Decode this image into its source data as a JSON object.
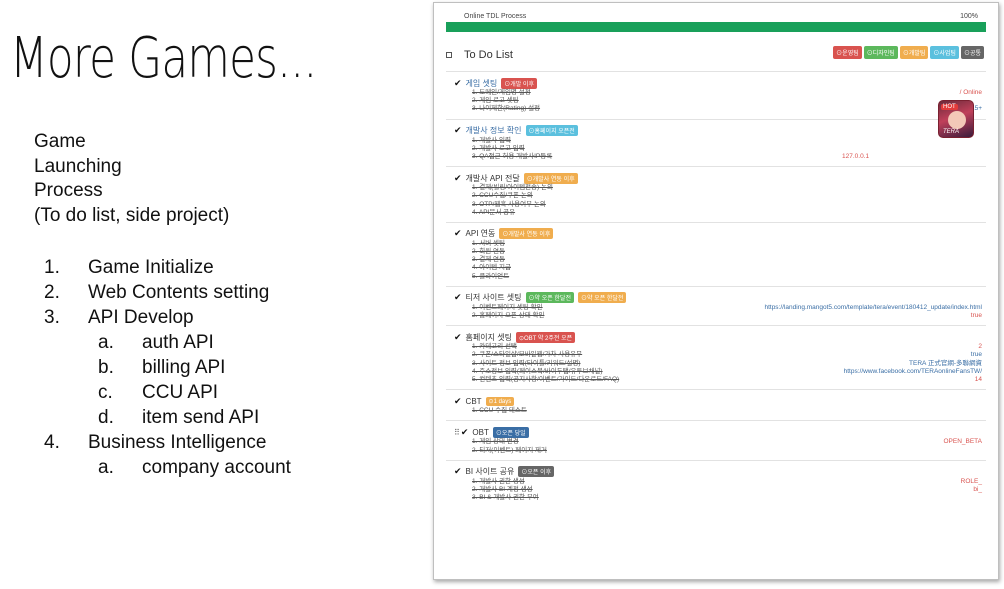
{
  "slide": {
    "title": "More Games...",
    "intro": [
      "Game",
      "Launching",
      "Process",
      "(To do list, side project)"
    ],
    "outline": [
      {
        "num": "1.",
        "text": "Game Initialize",
        "subs": []
      },
      {
        "num": "2.",
        "text": "Web Contents setting",
        "subs": []
      },
      {
        "num": "3.",
        "text": "API Develop",
        "subs": [
          {
            "num": "a.",
            "text": "auth API"
          },
          {
            "num": "b.",
            "text": "billing API"
          },
          {
            "num": "c.",
            "text": "CCU API"
          },
          {
            "num": "d.",
            "text": "item send API"
          }
        ]
      },
      {
        "num": "4.",
        "text": "Business Intelligence",
        "subs": [
          {
            "num": "a.",
            "text": "company account"
          }
        ]
      }
    ]
  },
  "screenshot": {
    "progress": {
      "label": "Online TDL Process",
      "percent_label": "100%",
      "value": 1.0,
      "color": "#19a05a"
    },
    "todo_title": "To Do List",
    "legend": [
      {
        "label": "⊙운영팀",
        "color": "#d9534f"
      },
      {
        "label": "⊙디자인팀",
        "color": "#5cb85c"
      },
      {
        "label": "⊙개발팀",
        "color": "#f0ad4e"
      },
      {
        "label": "⊙사업팀",
        "color": "#5bc0de"
      },
      {
        "label": "⊙공통",
        "color": "#666666"
      }
    ],
    "game_icon": {
      "badge": "HOT",
      "label": "TERA"
    },
    "cards": [
      {
        "title": "게임 셋팅",
        "title_color": "#3a6ea5",
        "drag": false,
        "tags": [
          {
            "label": "⊙개발 이후",
            "color": "#d9534f"
          }
        ],
        "items": [
          {
            "text": "1. 도메인/게임명 설정",
            "right": "/       Online",
            "right_color": "#d9534f"
          },
          {
            "text": "2. 게임 로고 셋팅"
          },
          {
            "text": "3. 나이제한(Rating) 설정",
            "right": "15+",
            "right_color": "#3a6ea5"
          }
        ]
      },
      {
        "title": "개발사 정보 확인",
        "title_color": "#3a6ea5",
        "drag": false,
        "tags": [
          {
            "label": "⊙홈페이지 오픈전",
            "color": "#5bc0de"
          }
        ],
        "items": [
          {
            "text": "1. 개발사 입력"
          },
          {
            "text": "2. 개발사 로고 입력"
          },
          {
            "text": "3. QA접근 허용 개발사IP등록",
            "mid": "127.0.0.1",
            "mid_color": "#d9534f"
          }
        ]
      },
      {
        "title": "개발사 API 전달",
        "title_color": "#333333",
        "drag": false,
        "tags": [
          {
            "label": "⊙개발사 연동 이후",
            "color": "#f0ad4e"
          }
        ],
        "items": [
          {
            "text": "1. 결제(빌링/아이템전송) 논의"
          },
          {
            "text": "2. CCU수집/쿠폰 논의"
          },
          {
            "text": "3. OTP/웹훅 사용여부 논의"
          },
          {
            "text": "4. API문서 공유"
          }
        ]
      },
      {
        "title": "API 연동",
        "title_color": "#333333",
        "drag": false,
        "tags": [
          {
            "label": "⊙개발사 연동 이후",
            "color": "#f0ad4e"
          }
        ],
        "items": [
          {
            "text": "1. 서버 셋팅"
          },
          {
            "text": "2. 회원 연동"
          },
          {
            "text": "3. 결제 연동"
          },
          {
            "text": "4. 아이템 지급"
          },
          {
            "text": "5. 클라이언트"
          }
        ]
      },
      {
        "title": "티저 사이트 셋팅",
        "title_color": "#333333",
        "drag": false,
        "tags": [
          {
            "label": "⊙약 오픈 한달전",
            "color": "#5cb85c"
          },
          {
            "label": "⊙약 오픈 한달전",
            "color": "#f0ad4e"
          }
        ],
        "items": [
          {
            "text": "1. 이벤트페이지 셋팅 확인",
            "right": "https://landing.mangot5.com/template/tera/event/180412_update/index.html",
            "right_color": "#3a6ea5"
          },
          {
            "text": "2. 홈페이지 오픈 상태 확인",
            "right": "true",
            "right_color": "#d9534f"
          }
        ]
      },
      {
        "title": "홈페이지 셋팅",
        "title_color": "#333333",
        "drag": false,
        "tags": [
          {
            "label": "⊙OBT 약 2주전 오픈",
            "color": "#d9534f"
          }
        ],
        "items": [
          {
            "text": "1. 카테고리 선택",
            "right": "2",
            "right_color": "#d9534f"
          },
          {
            "text": "2. 쿠폰/스타일샵/모바일웹/가차 사용유무",
            "right": "true",
            "right_color": "#3a6ea5"
          },
          {
            "text": "3. 사이트 정보 입력(타이틀/키워드/설명)",
            "right": "TERA 正式官網-多聯網資",
            "right_color": "#3a6ea5"
          },
          {
            "text": "4. 주소정보 입력(페이스북/바이두탭/유투브채널)",
            "right": "https://www.facebook.com/TERAonlineFansTW/",
            "right_color": "#3a6ea5"
          },
          {
            "text": "5. 컨텐츠 입력(공지사항/이벤트/가이드/다운로드/FAQ)",
            "right": "14",
            "right_color": "#d9534f"
          }
        ]
      },
      {
        "title": "CBT",
        "title_color": "#333333",
        "drag": false,
        "tags": [
          {
            "label": "⊙1 days",
            "color": "#f0ad4e"
          }
        ],
        "items": [
          {
            "text": "1. CCU 수집 테스트"
          }
        ]
      },
      {
        "title": "OBT",
        "title_color": "#333333",
        "drag": true,
        "tags": [
          {
            "label": "⊙오픈 당일",
            "color": "#3a6ea5"
          }
        ],
        "items": [
          {
            "text": "1. 게임 상태 변경",
            "right": "OPEN_BETA",
            "right_color": "#d9534f"
          },
          {
            "text": "2. 티저(이벤트) 페이지 제거"
          }
        ]
      },
      {
        "title": "BI 사이트 공유",
        "title_color": "#333333",
        "drag": false,
        "tags": [
          {
            "label": "⊙오픈 이후",
            "color": "#666666"
          }
        ],
        "items": [
          {
            "text": "1. 개발사 권한 생성",
            "right": "ROLE_",
            "right_color": "#d9534f"
          },
          {
            "text": "2. 개발사 BI 계정 생성",
            "right": "bi_",
            "right_color": "#d9534f"
          },
          {
            "text": "3. BI & 개발사 권한 부여"
          }
        ]
      }
    ]
  }
}
